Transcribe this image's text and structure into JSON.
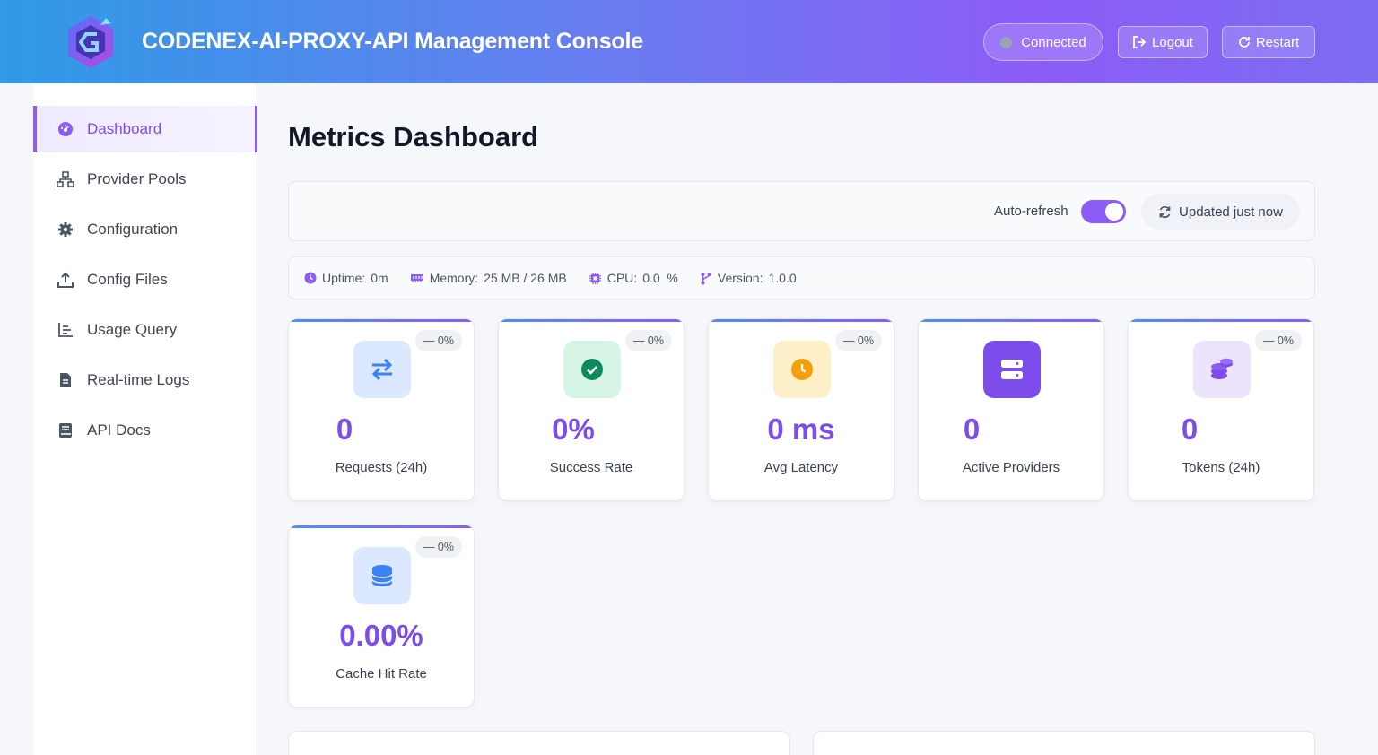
{
  "header": {
    "title": "CODENEX-AI-PROXY-API Management Console",
    "status_label": "Connected",
    "logout_label": "Logout",
    "restart_label": "Restart"
  },
  "sidebar": {
    "items": [
      {
        "label": "Dashboard",
        "icon": "gauge-icon",
        "active": true
      },
      {
        "label": "Provider Pools",
        "icon": "network-icon"
      },
      {
        "label": "Configuration",
        "icon": "gear-icon"
      },
      {
        "label": "Config Files",
        "icon": "upload-icon"
      },
      {
        "label": "Usage Query",
        "icon": "chart-icon"
      },
      {
        "label": "Real-time Logs",
        "icon": "file-icon"
      },
      {
        "label": "API Docs",
        "icon": "book-icon"
      }
    ]
  },
  "main": {
    "title": "Metrics Dashboard",
    "auto_refresh_label": "Auto-refresh",
    "auto_refresh_on": true,
    "updated_label": "Updated just now"
  },
  "system": {
    "uptime_label": "Uptime:",
    "uptime": "0m",
    "memory_label": "Memory:",
    "memory": "25 MB / 26 MB",
    "cpu_label": "CPU:",
    "cpu": "0.0  %",
    "version_label": "Version:",
    "version": "1.0.0"
  },
  "cards": [
    {
      "value": "0",
      "label": "Requests (24h)",
      "trend": "— 0%",
      "icon": "swap-arrows-icon"
    },
    {
      "value": "0%",
      "label": "Success Rate",
      "trend": "— 0%",
      "icon": "check-circle-icon"
    },
    {
      "value": "0 ms",
      "label": "Avg Latency",
      "trend": "— 0%",
      "icon": "clock-icon"
    },
    {
      "value": "0",
      "label": "Active Providers",
      "icon": "server-icon"
    },
    {
      "value": "0",
      "label": "Tokens (24h)",
      "trend": "— 0%",
      "icon": "coins-icon"
    },
    {
      "value": "0.00%",
      "label": "Cache Hit Rate",
      "trend": "— 0%",
      "icon": "database-icon"
    }
  ],
  "colors": {
    "accent": "#8b5cf6",
    "header_start": "#2f9be6",
    "header_end": "#7c6cf2"
  }
}
